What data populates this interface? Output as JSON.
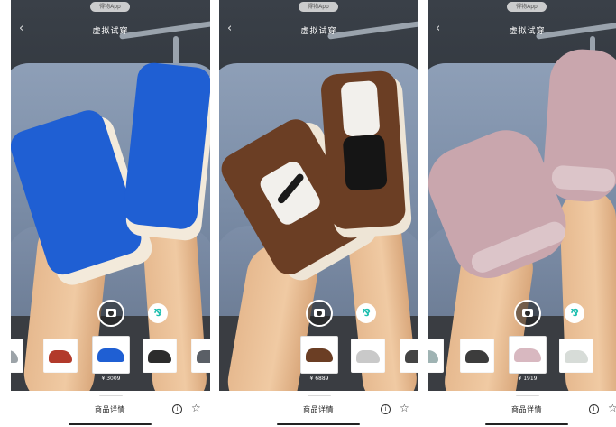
{
  "panels": [
    {
      "app_chip": "得物App",
      "title": "虚拟试穿",
      "shoe_color": "#1f5fd3",
      "thumbs": [
        {
          "shoe": "#9ca3a8",
          "selected": false
        },
        {
          "shoe": "#b23a2b",
          "selected": false
        },
        {
          "shoe": "#1f5fd3",
          "selected": true,
          "price": "¥ 3009"
        },
        {
          "shoe": "#2c2c2c",
          "selected": false
        },
        {
          "shoe": "#5a5f66",
          "selected": false
        }
      ],
      "details_label": "商品详情"
    },
    {
      "app_chip": "得物App",
      "title": "虚拟试穿",
      "shoe_color": "#6b3e24",
      "thumbs": [
        {
          "shoe": "#6b3e24",
          "selected": true,
          "price": "¥ 6889"
        },
        {
          "shoe": "#c9c9c9",
          "selected": false
        },
        {
          "shoe": "#444444",
          "selected": false
        }
      ],
      "details_label": "商品详情"
    },
    {
      "app_chip": "得物App",
      "title": "虚拟试穿",
      "shoe_color": "#c9a6ad",
      "thumbs": [
        {
          "shoe": "#9fb3b3",
          "selected": false
        },
        {
          "shoe": "#3c3c3c",
          "selected": false
        },
        {
          "shoe": "#d8b8c0",
          "selected": true,
          "price": "¥ 1919"
        },
        {
          "shoe": "#d7dcd8",
          "selected": false
        }
      ],
      "details_label": "商品详情"
    }
  ],
  "icons": {
    "back": "back-chevron-icon",
    "camera": "camera-icon",
    "filter": "filter-icon",
    "info": "info-icon",
    "favorite": "star-icon"
  }
}
